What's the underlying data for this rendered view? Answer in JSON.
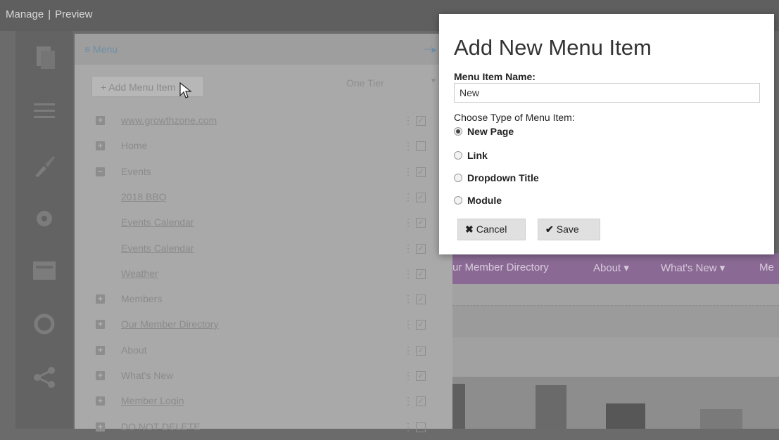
{
  "topbar": {
    "manage": "Manage",
    "separator": "|",
    "preview": "Preview"
  },
  "menu_panel": {
    "title": "≡ Menu",
    "add_button": "+ Add Menu Item",
    "tier_select": "One Tier",
    "items": [
      {
        "label": "www.growthzone.com",
        "expander": "+",
        "indent": false,
        "checked": true,
        "link": true
      },
      {
        "label": "Home",
        "expander": "+",
        "indent": false,
        "checked": false,
        "link": false
      },
      {
        "label": "Events",
        "expander": "−",
        "indent": false,
        "checked": true,
        "link": false
      },
      {
        "label": "2018 BBQ",
        "expander": "",
        "indent": true,
        "checked": true,
        "link": true
      },
      {
        "label": "Events Calendar",
        "expander": "",
        "indent": true,
        "checked": true,
        "link": true
      },
      {
        "label": "Events Calendar",
        "expander": "",
        "indent": true,
        "checked": true,
        "link": true
      },
      {
        "label": "Weather",
        "expander": "",
        "indent": true,
        "checked": true,
        "link": true
      },
      {
        "label": "Members",
        "expander": "+",
        "indent": false,
        "checked": true,
        "link": false
      },
      {
        "label": "Our Member Directory",
        "expander": "+",
        "indent": false,
        "checked": true,
        "link": true
      },
      {
        "label": "About",
        "expander": "+",
        "indent": false,
        "checked": true,
        "link": false
      },
      {
        "label": "What's New",
        "expander": "+",
        "indent": false,
        "checked": true,
        "link": false
      },
      {
        "label": "Member Login",
        "expander": "+",
        "indent": false,
        "checked": true,
        "link": true
      },
      {
        "label": "DO NOT DELETE",
        "expander": "+",
        "indent": false,
        "checked": false,
        "link": false
      }
    ]
  },
  "site_nav": {
    "links": [
      "ur Member Directory",
      "About ▾",
      "What's New ▾",
      "Me"
    ]
  },
  "modal": {
    "title": "Add New Menu Item",
    "name_label": "Menu Item Name:",
    "name_value": "New",
    "type_label": "Choose Type of Menu Item:",
    "options": [
      "New Page",
      "Link",
      "Dropdown Title",
      "Module"
    ],
    "selected_option": "New Page",
    "cancel_label": "Cancel",
    "save_label": "Save"
  },
  "icons": {
    "cancel": "x-icon",
    "save": "checkmark-icon",
    "pin": "pin-icon",
    "drag": "drag-handle-icon",
    "cursor": "mouse-cursor-icon"
  }
}
